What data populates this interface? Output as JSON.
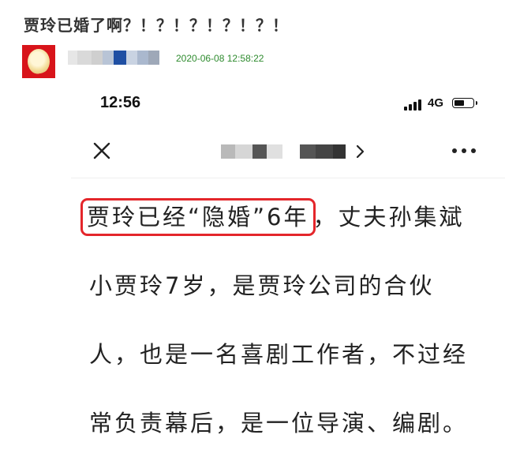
{
  "post": {
    "title": "贾玲已婚了啊？！？！？！？！？！",
    "timestamp": "2020-06-08 12:58:22"
  },
  "colors": {
    "timestamp": "#2e8b2e",
    "highlight_border": "#e4262b",
    "avatar_bg": "#d8141a"
  },
  "phone": {
    "status_bar": {
      "time": "12:56",
      "network": "4G",
      "battery_level": 0.55
    },
    "nav": {
      "close_icon": "close-icon",
      "chevron_icon": "chevron-right-icon",
      "more_icon": "more-dots-icon"
    },
    "article": {
      "line1_highlight": "贾玲已经“隐婚”6年",
      "line1_rest": "，丈夫孙集斌",
      "line2": "小贾玲7岁，是贾玲公司的合伙",
      "line3": "人，也是一名喜剧工作者，不过经",
      "line4": "常负责幕后，是一位导演、编剧。"
    }
  }
}
